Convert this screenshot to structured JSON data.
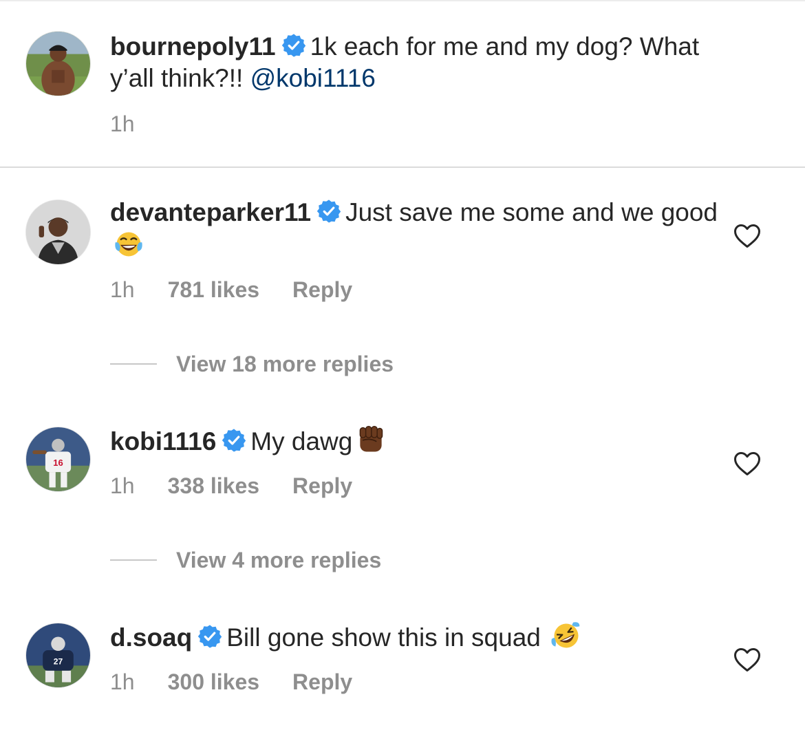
{
  "caption": {
    "username": "bournepoly11",
    "text": "1k each for me and my dog? What y’all think?!!",
    "mention": "@kobi1116",
    "time": "1h"
  },
  "comments": [
    {
      "username": "devanteparker11",
      "text": "Just save me some and we good",
      "emoji": "face-with-tears-of-joy",
      "time": "1h",
      "likes": "781 likes",
      "reply_label": "Reply",
      "view_replies": "View 18 more replies"
    },
    {
      "username": "kobi1116",
      "text": "My dawg",
      "emoji": "raised-fist-dark-skin",
      "time": "1h",
      "likes": "338 likes",
      "reply_label": "Reply",
      "view_replies": "View 4 more replies"
    },
    {
      "username": "d.soaq",
      "text": "Bill gone show this in squad",
      "emoji": "rolling-on-the-floor-laughing",
      "time": "1h",
      "likes": "300 likes",
      "reply_label": "Reply"
    }
  ],
  "colors": {
    "text": "#262626",
    "secondary": "#8e8e8e",
    "mention": "#00376b",
    "verified": "#3897f0"
  }
}
